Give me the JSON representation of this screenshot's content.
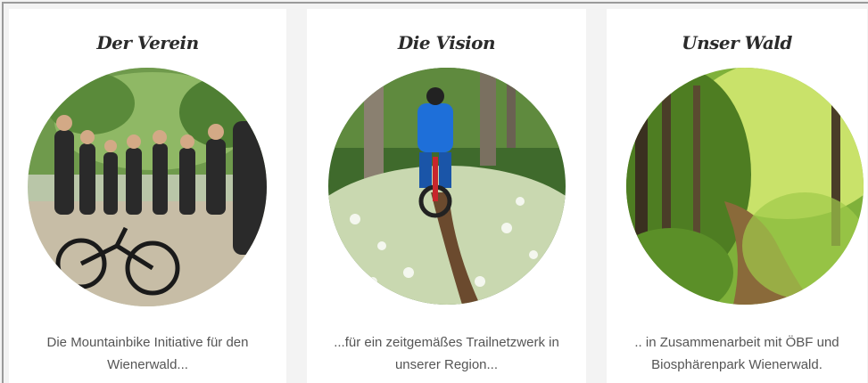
{
  "cards": [
    {
      "title": "Der Verein",
      "text_line1": "Die Mountainbike Initiative für den",
      "text_line2": "Wienerwald...",
      "image": "group-of-mountainbikers-photo"
    },
    {
      "title": "Die Vision",
      "text_line1": "...für ein zeitgemäßes Trailnetzwerk in",
      "text_line2": "unserer Region...",
      "image": "rider-on-forest-trail-photo"
    },
    {
      "title": "Unser Wald",
      "text_line1": ".. in Zusammenarbeit mit ÖBF und",
      "text_line2": "Biosphärenpark Wienerwald.",
      "image": "sunlit-forest-path-photo"
    }
  ],
  "colors": {
    "background": "#f3f3f3",
    "card": "#ffffff",
    "title": "#2b2b2b",
    "text": "#555555"
  }
}
